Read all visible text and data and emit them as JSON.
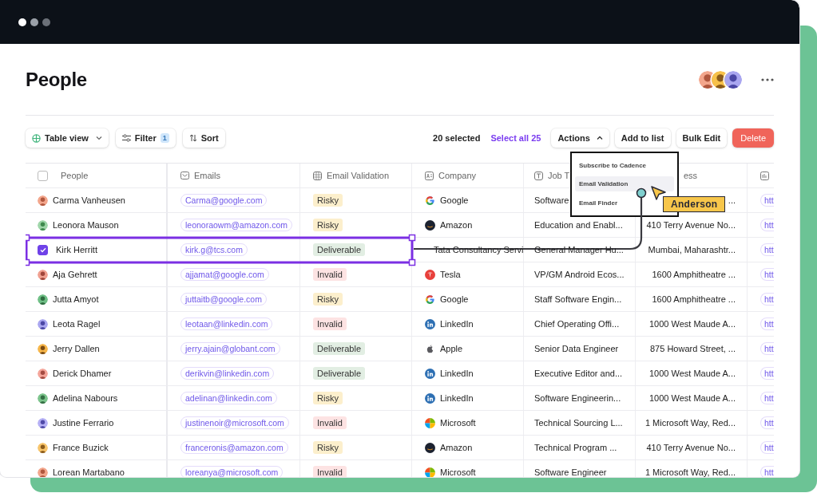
{
  "page": {
    "title": "People"
  },
  "toolbar": {
    "view_button": "Table view",
    "filter_button": "Filter",
    "filter_count": "1",
    "sort_button": "Sort",
    "selected_count": "20 selected",
    "select_all_link": "Select all 25",
    "actions_button": "Actions",
    "actions_expanded": true,
    "buttons": [
      {
        "label": "Add to list",
        "kind": "default"
      },
      {
        "label": "Bulk Edit",
        "kind": "default"
      },
      {
        "label": "Delete",
        "kind": "danger"
      }
    ]
  },
  "actions_menu": {
    "items": [
      {
        "label": "Subscribe to Cadence",
        "selected": false
      },
      {
        "label": "Email Validation",
        "selected": true
      },
      {
        "label": "Email Finder",
        "selected": false
      }
    ]
  },
  "table": {
    "select_all_checked": false,
    "columns": [
      {
        "label": "People"
      },
      {
        "label": "Emails"
      },
      {
        "label": "Email Validation"
      },
      {
        "label": "Company"
      },
      {
        "label": "Job T"
      },
      {
        "label": "ess"
      },
      {}
    ],
    "rows": [
      {
        "name": "Carma Vanheusen",
        "checked": false,
        "selected": false,
        "email": "Carma@google.com",
        "validation": {
          "label": "Risky",
          "kind": "risky"
        },
        "company": {
          "name": "Google",
          "kind": "google"
        },
        "job_title": "Software",
        "address": "...",
        "link": "htt"
      },
      {
        "name": "Leonora Mauson",
        "checked": false,
        "selected": false,
        "email": "leonoraowm@amazon.com",
        "validation": {
          "label": "Risky",
          "kind": "risky"
        },
        "company": {
          "name": "Amazon",
          "kind": "amazon"
        },
        "job_title": "Education and Enabl...",
        "address": "410 Terry Avenue No...",
        "link": "htt"
      },
      {
        "name": "Kirk Herritt",
        "checked": true,
        "selected": true,
        "email": "kirk.g@tcs.com",
        "validation": {
          "label": "Deliverable",
          "kind": "deliverable"
        },
        "company": {
          "name": "Tata Consultancy Servi",
          "kind": "tata"
        },
        "job_title": "General Manager Hu...",
        "address": "Mumbai, Maharashtr...",
        "link": "htt"
      },
      {
        "name": "Aja Gehrett",
        "checked": false,
        "selected": false,
        "email": "ajjamat@google.com",
        "validation": {
          "label": "Invalid",
          "kind": "invalid"
        },
        "company": {
          "name": "Tesla",
          "kind": "tesla"
        },
        "job_title": "VP/GM Android Ecos...",
        "address": "1600 Amphitheatre ...",
        "link": "htt"
      },
      {
        "name": "Jutta Amyot",
        "checked": false,
        "selected": false,
        "email": "juttaitb@google.com",
        "validation": {
          "label": "Risky",
          "kind": "risky"
        },
        "company": {
          "name": "Google",
          "kind": "google"
        },
        "job_title": "Staff Software Engin...",
        "address": "1600 Amphitheatre ...",
        "link": "htt"
      },
      {
        "name": "Leota Ragel",
        "checked": false,
        "selected": false,
        "email": "leotaan@linkedin.com",
        "validation": {
          "label": "Invalid",
          "kind": "invalid"
        },
        "company": {
          "name": "LinkedIn",
          "kind": "linkedin"
        },
        "job_title": "Chief Operating Offi...",
        "address": "1000 West Maude A...",
        "link": "htt"
      },
      {
        "name": "Jerry Dallen",
        "checked": false,
        "selected": false,
        "email": "jerry.ajain@globant.com",
        "validation": {
          "label": "Deliverable",
          "kind": "deliverable"
        },
        "company": {
          "name": "Apple",
          "kind": "apple"
        },
        "job_title": "Senior Data Engineer",
        "address": "875 Howard Street, ...",
        "link": "htt"
      },
      {
        "name": "Derick Dhamer",
        "checked": false,
        "selected": false,
        "email": "derikvin@linkedin.com",
        "validation": {
          "label": "Deliverable",
          "kind": "deliverable"
        },
        "company": {
          "name": "LinkedIn",
          "kind": "linkedin"
        },
        "job_title": "Executive Editor and...",
        "address": "1000 West Maude A...",
        "link": "htt"
      },
      {
        "name": "Adelina Nabours",
        "checked": false,
        "selected": false,
        "email": "adelinan@linkedin.com",
        "validation": {
          "label": "Risky",
          "kind": "risky"
        },
        "company": {
          "name": "LinkedIn",
          "kind": "linkedin"
        },
        "job_title": "Software Engineerin...",
        "address": "1000 West Maude A...",
        "link": "htt"
      },
      {
        "name": "Justine Ferrario",
        "checked": false,
        "selected": false,
        "email": "justinenoir@microsoft.com",
        "validation": {
          "label": "Invalid",
          "kind": "invalid"
        },
        "company": {
          "name": "Microsoft",
          "kind": "microsoft"
        },
        "job_title": "Technical Sourcing L...",
        "address": "1 Microsoft Way, Red...",
        "link": "htt"
      },
      {
        "name": "France Buzick",
        "checked": false,
        "selected": false,
        "email": "franceronis@amazon.com",
        "validation": {
          "label": "Risky",
          "kind": "risky"
        },
        "company": {
          "name": "Amazon",
          "kind": "amazon"
        },
        "job_title": "Technical Program ...",
        "address": "410 Terry Avenue No...",
        "link": "htt"
      },
      {
        "name": "Lorean Martabano",
        "checked": false,
        "selected": false,
        "email": "loreanya@microsoft.com",
        "validation": {
          "label": "Invalid",
          "kind": "invalid"
        },
        "company": {
          "name": "Microsoft",
          "kind": "microsoft"
        },
        "job_title": "Software Engineer",
        "address": "1 Microsoft Way, Red...",
        "link": "htt"
      }
    ]
  },
  "collaborator_cursor": {
    "name": "Anderson"
  }
}
